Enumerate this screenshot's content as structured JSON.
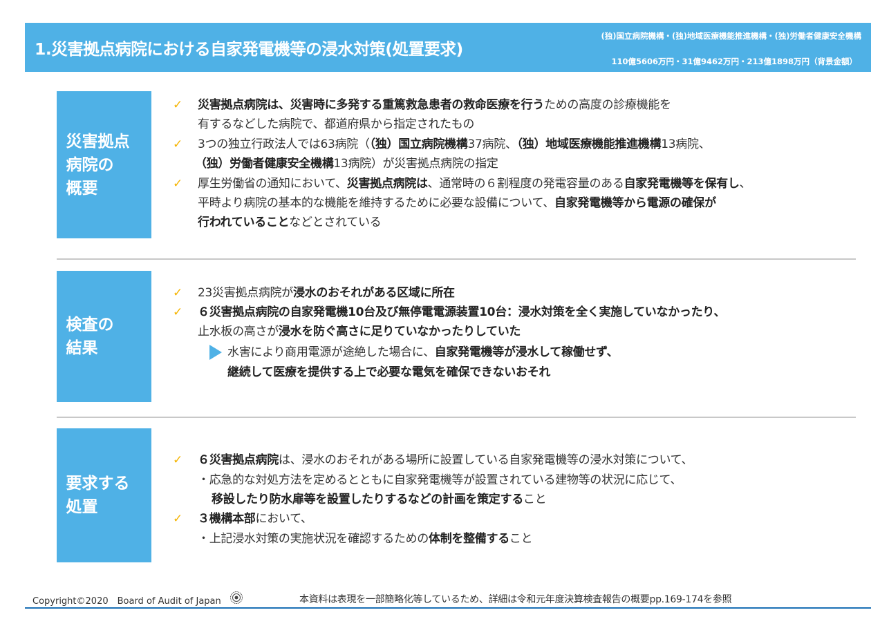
{
  "header": {
    "title": "1.災害拠点病院における自家発電機等の浸水対策(処置要求)",
    "orgs": "(独)国立病院機構・(独)地域医療機能推進機構・(独)労働者健康安全機構",
    "amounts": "110億5606万円・31億9462万円・213億1898万円（背景金額）"
  },
  "check_mark": "✓",
  "sections": [
    {
      "label": "災害拠点\n病院の\n概要",
      "lines": [
        [
          "災害拠点病院は、災害時に多発する重篤救急患者の救命医療を行う",
          "ための高度の診療機能を"
        ],
        [
          "有するなどした病院で、都道府県から指定されたもの"
        ],
        [
          "3つの独立行政法人では63病院（",
          "（独）国立病院機構",
          "37病院、",
          "（独）地域医療機能推進機構",
          "13病院、"
        ],
        [
          "（独）労働者健康安全機構",
          "13病院）が災害拠点病院の指定"
        ],
        [
          "厚生労働省の通知において、",
          "災害拠点病院は",
          "、通常時の６割程度の発電容量のある",
          "自家発電機等を保有し",
          "、"
        ],
        [
          "平時より病院の基本的な機能を維持するために必要な設備について、",
          "自家発電機等から電源の確保が"
        ],
        [
          "行われていること",
          "などとされている"
        ]
      ]
    },
    {
      "label": "検査の\n結果",
      "lines": [
        [
          "23災害拠点病院が",
          "浸水のおそれがある区域に所在"
        ],
        [
          "６災害拠点病院の自家発電機10台及び無停電電源装置10台：浸水対策を全く実施していなかったり、"
        ],
        [
          "止水板の高さが",
          "浸水を防ぐ高さに足りていなかったりしていた"
        ],
        [
          "水害により商用電源が途絶した場合に、",
          "自家発電機等が浸水して稼働せず、"
        ],
        [
          "継続して医療を提供する上で必要な電気を確保できないおそれ"
        ]
      ]
    },
    {
      "label": "要求する\n処置",
      "lines": [
        [
          "６災害拠点病院",
          "は、浸水のおそれがある場所に設置している自家発電機等の浸水対策について、"
        ],
        [
          "・応急的な対処方法を定めるとともに自家発電機等が設置されている建物等の状況に応じて、"
        ],
        [
          "移設したり防水扉等を設置したりするなどの計画を策定する",
          "こと"
        ],
        [
          "３機構本部",
          "において、"
        ],
        [
          "・上記浸水対策の実施状況を確認するための",
          "体制を整備する",
          "こと"
        ]
      ]
    }
  ],
  "footer": {
    "copyright": "Copyright©2020　Board of Audit of Japan",
    "note": "本資料は表現を一部簡略化等しているため、詳細は令和元年度決算検査報告の概要pp.169-174を参照"
  }
}
